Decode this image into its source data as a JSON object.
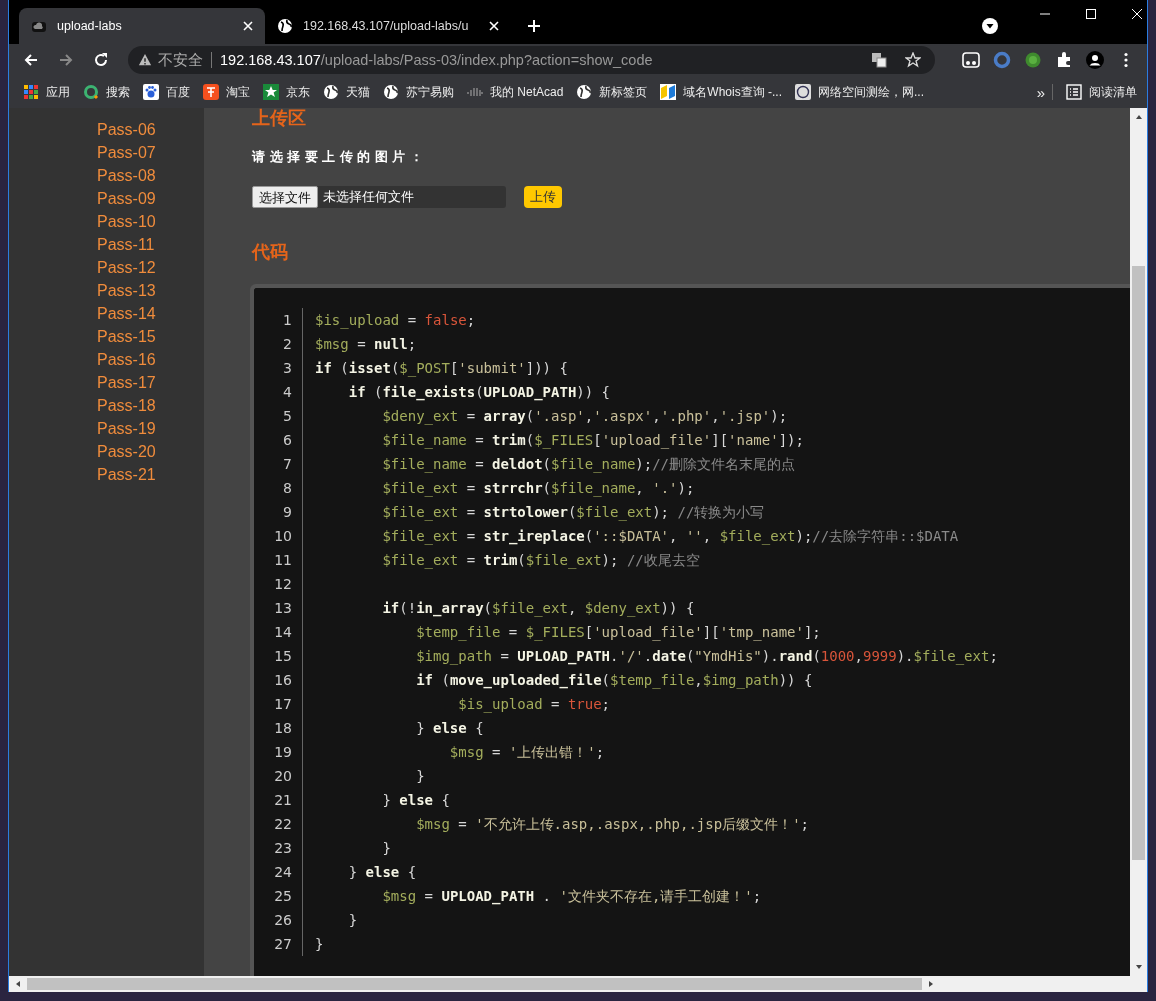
{
  "tabs": [
    {
      "title": "upload-labs",
      "selected": true
    },
    {
      "title": "192.168.43.107/upload-labs/u",
      "selected": false
    }
  ],
  "address_bar": {
    "security": "不安全",
    "host": "192.168.43.107",
    "path": "/upload-labs/Pass-03/index.php?action=show_code"
  },
  "bookmarks": [
    "应用",
    "搜索",
    "百度",
    "淘宝",
    "京东",
    "天猫",
    "苏宁易购",
    "我的 NetAcad",
    "新标签页",
    "域名Whois查询 -...",
    "网络空间测绘，网..."
  ],
  "bookmarks_more": "»",
  "reading_list": "阅读清单",
  "sidebar": {
    "items": [
      "Pass-06",
      "Pass-07",
      "Pass-08",
      "Pass-09",
      "Pass-10",
      "Pass-11",
      "Pass-12",
      "Pass-13",
      "Pass-14",
      "Pass-15",
      "Pass-16",
      "Pass-17",
      "Pass-18",
      "Pass-19",
      "Pass-20",
      "Pass-21"
    ]
  },
  "upload": {
    "heading": "上传区",
    "prompt": "请选择要上传的图片：",
    "choose_button": "选择文件",
    "file_status": "未选择任何文件",
    "submit_button": "上传"
  },
  "code": {
    "heading": "代码",
    "lines": [
      {
        "number": "1",
        "tokens": [
          {
            "kind": "variable",
            "text": "$is_upload"
          },
          {
            "kind": "plain",
            "text": " = "
          },
          {
            "kind": "literal",
            "text": "false"
          },
          {
            "kind": "plain",
            "text": ";"
          }
        ]
      },
      {
        "number": "2",
        "tokens": [
          {
            "kind": "variable",
            "text": "$msg"
          },
          {
            "kind": "plain",
            "text": " = "
          },
          {
            "kind": "function",
            "text": "null"
          },
          {
            "kind": "plain",
            "text": ";"
          }
        ]
      },
      {
        "number": "3",
        "tokens": [
          {
            "kind": "function",
            "text": "if"
          },
          {
            "kind": "plain",
            "text": " ("
          },
          {
            "kind": "function",
            "text": "isset"
          },
          {
            "kind": "plain",
            "text": "("
          },
          {
            "kind": "variable",
            "text": "$_POST"
          },
          {
            "kind": "plain",
            "text": "["
          },
          {
            "kind": "string",
            "text": "'submit'"
          },
          {
            "kind": "plain",
            "text": "])) {"
          }
        ]
      },
      {
        "number": "4",
        "tokens": [
          {
            "kind": "function",
            "text": "    if"
          },
          {
            "kind": "plain",
            "text": " ("
          },
          {
            "kind": "function",
            "text": "file_exists"
          },
          {
            "kind": "plain",
            "text": "("
          },
          {
            "kind": "function",
            "text": "UPLOAD_PATH"
          },
          {
            "kind": "plain",
            "text": ")) {"
          }
        ]
      },
      {
        "number": "5",
        "tokens": [
          {
            "kind": "variable",
            "text": "        $deny_ext"
          },
          {
            "kind": "plain",
            "text": " = "
          },
          {
            "kind": "function",
            "text": "array"
          },
          {
            "kind": "plain",
            "text": "("
          },
          {
            "kind": "string",
            "text": "'.asp'"
          },
          {
            "kind": "plain",
            "text": ","
          },
          {
            "kind": "string",
            "text": "'.aspx'"
          },
          {
            "kind": "plain",
            "text": ","
          },
          {
            "kind": "string",
            "text": "'.php'"
          },
          {
            "kind": "plain",
            "text": ","
          },
          {
            "kind": "string",
            "text": "'.jsp'"
          },
          {
            "kind": "plain",
            "text": ");"
          }
        ]
      },
      {
        "number": "6",
        "tokens": [
          {
            "kind": "variable",
            "text": "        $file_name"
          },
          {
            "kind": "plain",
            "text": " = "
          },
          {
            "kind": "function",
            "text": "trim"
          },
          {
            "kind": "plain",
            "text": "("
          },
          {
            "kind": "variable",
            "text": "$_FILES"
          },
          {
            "kind": "plain",
            "text": "["
          },
          {
            "kind": "string",
            "text": "'upload_file'"
          },
          {
            "kind": "plain",
            "text": "]["
          },
          {
            "kind": "string",
            "text": "'name'"
          },
          {
            "kind": "plain",
            "text": "]);"
          }
        ]
      },
      {
        "number": "7",
        "tokens": [
          {
            "kind": "variable",
            "text": "        $file_name"
          },
          {
            "kind": "plain",
            "text": " = "
          },
          {
            "kind": "function",
            "text": "deldot"
          },
          {
            "kind": "plain",
            "text": "("
          },
          {
            "kind": "variable",
            "text": "$file_name"
          },
          {
            "kind": "plain",
            "text": ");"
          },
          {
            "kind": "comment",
            "text": "//删除文件名末尾的点"
          }
        ]
      },
      {
        "number": "8",
        "tokens": [
          {
            "kind": "variable",
            "text": "        $file_ext"
          },
          {
            "kind": "plain",
            "text": " = "
          },
          {
            "kind": "function",
            "text": "strrchr"
          },
          {
            "kind": "plain",
            "text": "("
          },
          {
            "kind": "variable",
            "text": "$file_name"
          },
          {
            "kind": "plain",
            "text": ", "
          },
          {
            "kind": "string",
            "text": "'.'"
          },
          {
            "kind": "plain",
            "text": ");"
          }
        ]
      },
      {
        "number": "9",
        "tokens": [
          {
            "kind": "variable",
            "text": "        $file_ext"
          },
          {
            "kind": "plain",
            "text": " = "
          },
          {
            "kind": "function",
            "text": "strtolower"
          },
          {
            "kind": "plain",
            "text": "("
          },
          {
            "kind": "variable",
            "text": "$file_ext"
          },
          {
            "kind": "plain",
            "text": "); "
          },
          {
            "kind": "comment",
            "text": "//转换为小写"
          }
        ]
      },
      {
        "number": "10",
        "tokens": [
          {
            "kind": "variable",
            "text": "        $file_ext"
          },
          {
            "kind": "plain",
            "text": " = "
          },
          {
            "kind": "function",
            "text": "str_ireplace"
          },
          {
            "kind": "plain",
            "text": "("
          },
          {
            "kind": "string",
            "text": "'::$DATA'"
          },
          {
            "kind": "plain",
            "text": ", "
          },
          {
            "kind": "string",
            "text": "''"
          },
          {
            "kind": "plain",
            "text": ", "
          },
          {
            "kind": "variable",
            "text": "$file_ext"
          },
          {
            "kind": "plain",
            "text": ");"
          },
          {
            "kind": "comment",
            "text": "//去除字符串::$DATA"
          }
        ]
      },
      {
        "number": "11",
        "tokens": [
          {
            "kind": "variable",
            "text": "        $file_ext"
          },
          {
            "kind": "plain",
            "text": " = "
          },
          {
            "kind": "function",
            "text": "trim"
          },
          {
            "kind": "plain",
            "text": "("
          },
          {
            "kind": "variable",
            "text": "$file_ext"
          },
          {
            "kind": "plain",
            "text": "); "
          },
          {
            "kind": "comment",
            "text": "//收尾去空"
          }
        ]
      },
      {
        "number": "12"
      },
      {
        "number": "13",
        "tokens": [
          {
            "kind": "function",
            "text": "        if"
          },
          {
            "kind": "plain",
            "text": "(!"
          },
          {
            "kind": "function",
            "text": "in_array"
          },
          {
            "kind": "plain",
            "text": "("
          },
          {
            "kind": "variable",
            "text": "$file_ext"
          },
          {
            "kind": "plain",
            "text": ", "
          },
          {
            "kind": "variable",
            "text": "$deny_ext"
          },
          {
            "kind": "plain",
            "text": ")) {"
          }
        ]
      },
      {
        "number": "14",
        "tokens": [
          {
            "kind": "variable",
            "text": "            $temp_file"
          },
          {
            "kind": "plain",
            "text": " = "
          },
          {
            "kind": "variable",
            "text": "$_FILES"
          },
          {
            "kind": "plain",
            "text": "["
          },
          {
            "kind": "string",
            "text": "'upload_file'"
          },
          {
            "kind": "plain",
            "text": "]["
          },
          {
            "kind": "string",
            "text": "'tmp_name'"
          },
          {
            "kind": "plain",
            "text": "];"
          }
        ]
      },
      {
        "number": "15",
        "tokens": [
          {
            "kind": "variable",
            "text": "            $img_path"
          },
          {
            "kind": "plain",
            "text": " = "
          },
          {
            "kind": "function",
            "text": "UPLOAD_PATH"
          },
          {
            "kind": "plain",
            "text": "."
          },
          {
            "kind": "string",
            "text": "'/'"
          },
          {
            "kind": "plain",
            "text": "."
          },
          {
            "kind": "function",
            "text": "date"
          },
          {
            "kind": "plain",
            "text": "("
          },
          {
            "kind": "string",
            "text": "\"YmdHis\""
          },
          {
            "kind": "plain",
            "text": ")."
          },
          {
            "kind": "function",
            "text": "rand"
          },
          {
            "kind": "plain",
            "text": "("
          },
          {
            "kind": "literal",
            "text": "1000"
          },
          {
            "kind": "plain",
            "text": ","
          },
          {
            "kind": "literal",
            "text": "9999"
          },
          {
            "kind": "plain",
            "text": ")."
          },
          {
            "kind": "variable",
            "text": "$file_ext"
          },
          {
            "kind": "plain",
            "text": ";"
          }
        ]
      },
      {
        "number": "16",
        "tokens": [
          {
            "kind": "function",
            "text": "            if"
          },
          {
            "kind": "plain",
            "text": " ("
          },
          {
            "kind": "function",
            "text": "move_uploaded_file"
          },
          {
            "kind": "plain",
            "text": "("
          },
          {
            "kind": "variable",
            "text": "$temp_file"
          },
          {
            "kind": "plain",
            "text": ","
          },
          {
            "kind": "variable",
            "text": "$img_path"
          },
          {
            "kind": "plain",
            "text": ")) {"
          }
        ]
      },
      {
        "number": "17",
        "tokens": [
          {
            "kind": "variable",
            "text": "                 $is_upload"
          },
          {
            "kind": "plain",
            "text": " = "
          },
          {
            "kind": "literal",
            "text": "true"
          },
          {
            "kind": "plain",
            "text": ";"
          }
        ]
      },
      {
        "number": "18",
        "tokens": [
          {
            "kind": "plain",
            "text": "            } "
          },
          {
            "kind": "function",
            "text": "else"
          },
          {
            "kind": "plain",
            "text": " {"
          }
        ]
      },
      {
        "number": "19",
        "tokens": [
          {
            "kind": "variable",
            "text": "                $msg"
          },
          {
            "kind": "plain",
            "text": " = "
          },
          {
            "kind": "string",
            "text": "'上传出错！'"
          },
          {
            "kind": "plain",
            "text": ";"
          }
        ]
      },
      {
        "number": "20",
        "tokens": [
          {
            "kind": "plain",
            "text": "            }"
          }
        ]
      },
      {
        "number": "21",
        "tokens": [
          {
            "kind": "plain",
            "text": "        } "
          },
          {
            "kind": "function",
            "text": "else"
          },
          {
            "kind": "plain",
            "text": " {"
          }
        ]
      },
      {
        "number": "22",
        "tokens": [
          {
            "kind": "variable",
            "text": "            $msg"
          },
          {
            "kind": "plain",
            "text": " = "
          },
          {
            "kind": "string",
            "text": "'不允许上传.asp,.aspx,.php,.jsp后缀文件！'"
          },
          {
            "kind": "plain",
            "text": ";"
          }
        ]
      },
      {
        "number": "23",
        "tokens": [
          {
            "kind": "plain",
            "text": "        }"
          }
        ]
      },
      {
        "number": "24",
        "tokens": [
          {
            "kind": "plain",
            "text": "    } "
          },
          {
            "kind": "function",
            "text": "else"
          },
          {
            "kind": "plain",
            "text": " {"
          }
        ]
      },
      {
        "number": "25",
        "tokens": [
          {
            "kind": "variable",
            "text": "        $msg"
          },
          {
            "kind": "plain",
            "text": " = "
          },
          {
            "kind": "function",
            "text": "UPLOAD_PATH"
          },
          {
            "kind": "plain",
            "text": " . "
          },
          {
            "kind": "string",
            "text": "'文件夹不存在,请手工创建！'"
          },
          {
            "kind": "plain",
            "text": ";"
          }
        ]
      },
      {
        "number": "26",
        "tokens": [
          {
            "kind": "plain",
            "text": "    }"
          }
        ]
      },
      {
        "number": "27",
        "tokens": [
          {
            "kind": "plain",
            "text": "}"
          }
        ]
      }
    ]
  }
}
